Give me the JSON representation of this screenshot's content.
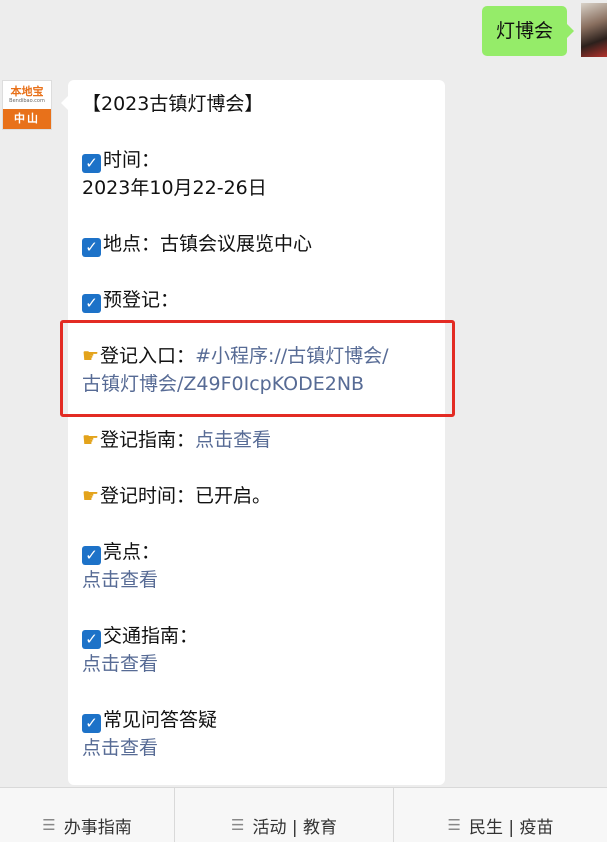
{
  "user_message": {
    "text": "灯博会"
  },
  "bot": {
    "logo_main": "本地宝",
    "logo_sub": "Bendibao.com",
    "logo_city": "中山"
  },
  "reply": {
    "title": "【2023古镇灯博会】",
    "time_label": "时间：",
    "time_value": "2023年10月22-26日",
    "place_label": "地点：古镇会议展览中心",
    "prereg_label": "预登记：",
    "entry_label": "登记入口：",
    "entry_link_part1": "#小程序://古镇灯博会/",
    "entry_link_part2": "古镇灯博会/Z49F0IcpKODE2NB",
    "guide_label": "登记指南：",
    "guide_link": "点击查看",
    "reg_time_label": "登记时间：已开启。",
    "highlights_label": "亮点：",
    "highlights_link": "点击查看",
    "traffic_label": "交通指南：",
    "traffic_link": "点击查看",
    "faq_label": "常见问答答疑",
    "faq_link": "点击查看"
  },
  "icons": {
    "check": "check-box-icon",
    "hand": "pointing-hand-icon",
    "menu": "menu-lines-icon"
  },
  "colors": {
    "user_bubble": "#95ec69",
    "link": "#576b95",
    "highlight_border": "#e32b23",
    "brand": "#e8711a"
  },
  "menu": [
    "办事指南",
    "活动 | 教育",
    "民生 | 疫苗"
  ]
}
